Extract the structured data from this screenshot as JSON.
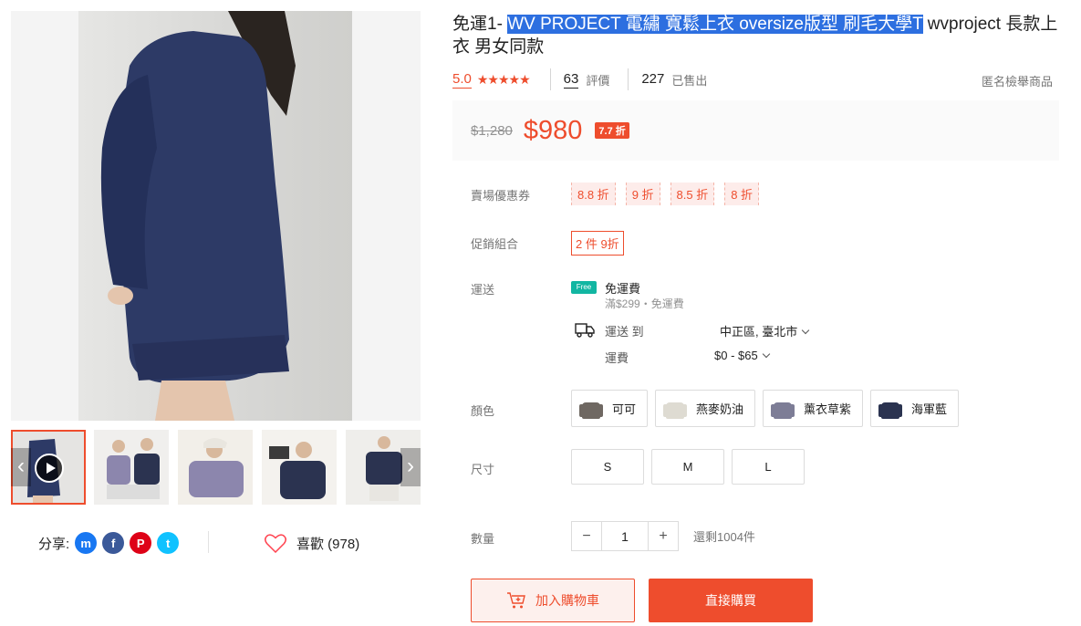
{
  "product": {
    "title_prefix": "免運1- ",
    "title_selected": "WV PROJECT 電繡 寬鬆上衣 oversize版型 刷毛大學T",
    "title_suffix": " wvproject 長款上衣 男女同款"
  },
  "stats": {
    "rating": "5.0",
    "stars": "★★★★★",
    "review_count": "63",
    "review_label": "評價",
    "sold_count": "227",
    "sold_label": "已售出",
    "report": "匿名檢舉商品"
  },
  "price": {
    "original": "$1,280",
    "current": "$980",
    "discount_badge": "7.7 折",
    "accent_color": "#ee4d2d"
  },
  "vouchers": {
    "label": "賣場優惠券",
    "items": [
      "8.8 折",
      "9 折",
      "8.5 折",
      "8 折"
    ]
  },
  "bundle": {
    "label": "促銷組合",
    "deal": "2 件 9折"
  },
  "shipping": {
    "label": "運送",
    "free_icon": "free-shipping-truck-icon",
    "free_badge": "Free",
    "free_title": "免運費",
    "free_condition": "滿$299・免運費",
    "to_label": "運送 到",
    "to_value": "中正區, 臺北市",
    "fee_label": "運費",
    "fee_value": "$0 - $65"
  },
  "colors": {
    "label": "顏色",
    "options": [
      {
        "name": "可可",
        "color": "#6f6862"
      },
      {
        "name": "燕麥奶油",
        "color": "#dedbd2"
      },
      {
        "name": "薰衣草紫",
        "color": "#7d7d96"
      },
      {
        "name": "海軍藍",
        "color": "#2b3350"
      }
    ]
  },
  "sizes": {
    "label": "尺寸",
    "options": [
      "S",
      "M",
      "L"
    ]
  },
  "quantity": {
    "label": "數量",
    "value": "1",
    "minus": "−",
    "plus": "+",
    "stock": "還剩1004件"
  },
  "actions": {
    "add_to_cart": "加入購物車",
    "buy_now": "直接購買"
  },
  "share": {
    "label": "分享:",
    "networks": [
      {
        "icon": "messenger-icon",
        "color": "#1877f2",
        "glyph": "m"
      },
      {
        "icon": "facebook-icon",
        "color": "#3b5999",
        "glyph": "f"
      },
      {
        "icon": "pinterest-icon",
        "color": "#de0217",
        "glyph": "P"
      },
      {
        "icon": "twitter-icon",
        "color": "#10c2ff",
        "glyph": "t"
      }
    ]
  },
  "like": {
    "label": "喜歡 (978)",
    "icon": "heart-icon"
  },
  "gallery": {
    "arrow_left": "‹",
    "arrow_right": "›"
  }
}
